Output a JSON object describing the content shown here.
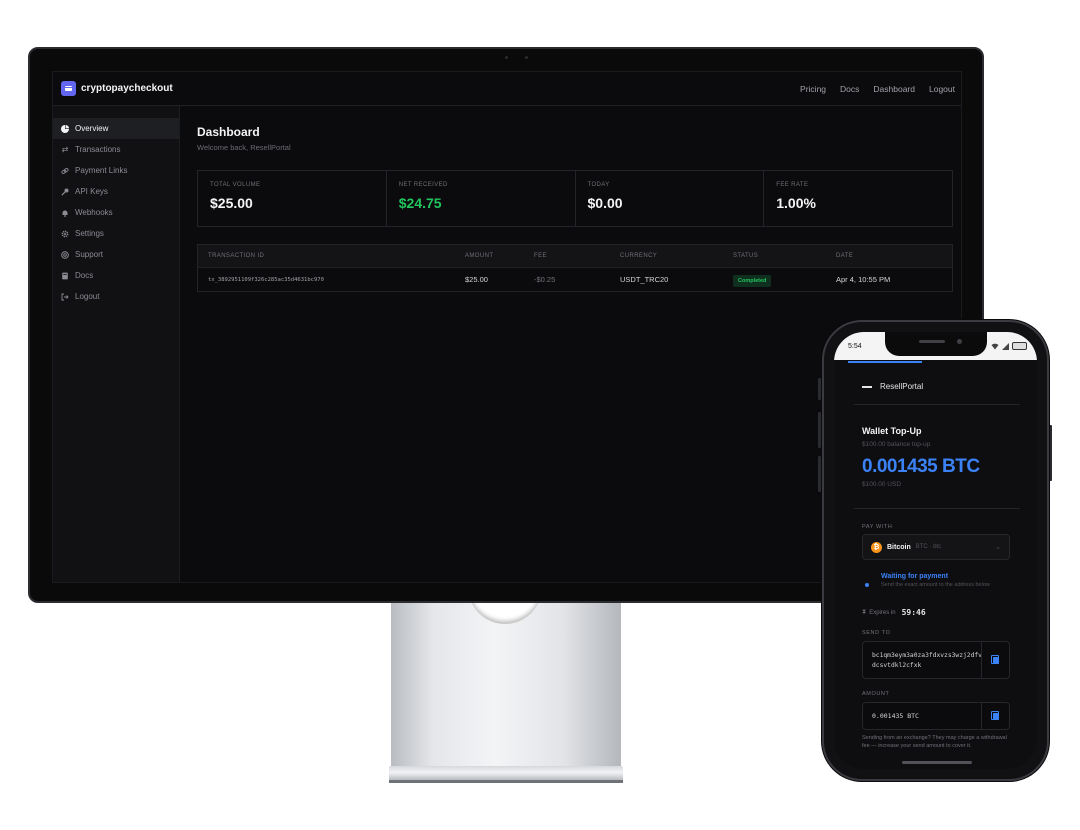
{
  "app": {
    "brand": "cryptopaycheckout",
    "nav": [
      "Pricing",
      "Docs",
      "Dashboard",
      "Logout"
    ]
  },
  "sidebar": {
    "items": [
      {
        "label": "Overview",
        "icon": "pie-chart-icon",
        "active": true
      },
      {
        "label": "Transactions",
        "icon": "arrows-swap-icon",
        "active": false
      },
      {
        "label": "Payment Links",
        "icon": "link-icon",
        "active": false
      },
      {
        "label": "API Keys",
        "icon": "key-icon",
        "active": false
      },
      {
        "label": "Webhooks",
        "icon": "bell-icon",
        "active": false
      },
      {
        "label": "Settings",
        "icon": "gear-icon",
        "active": false
      },
      {
        "label": "Support",
        "icon": "lifebuoy-icon",
        "active": false
      },
      {
        "label": "Docs",
        "icon": "book-icon",
        "active": false
      },
      {
        "label": "Logout",
        "icon": "logout-icon",
        "active": false
      }
    ]
  },
  "dashboard": {
    "title": "Dashboard",
    "subtitle": "Welcome back, ResellPortal",
    "stats": [
      {
        "label": "TOTAL VOLUME",
        "value": "$25.00",
        "accent": "#f4f4f5"
      },
      {
        "label": "NET RECEIVED",
        "value": "$24.75",
        "accent": "#22c55e"
      },
      {
        "label": "TODAY",
        "value": "$0.00",
        "accent": "#f4f4f5"
      },
      {
        "label": "FEE RATE",
        "value": "1.00%",
        "accent": "#f4f4f5"
      }
    ],
    "table": {
      "headers": [
        "TRANSACTION ID",
        "AMOUNT",
        "FEE",
        "CURRENCY",
        "STATUS",
        "DATE"
      ],
      "rows": [
        {
          "id": "tx_3892951109f326c285ac35d4631bc970",
          "amount": "$25.00",
          "fee": "-$0.25",
          "currency": "USDT_TRC20",
          "status": "Completed",
          "date": "Apr 4, 10:55 PM"
        }
      ]
    }
  },
  "phone": {
    "status_time": "5:54",
    "merchant": "ResellPortal",
    "title": "Wallet Top-Up",
    "subtitle": "$100.00 balance top-up",
    "amount_crypto": "0.001435 BTC",
    "amount_usd": "$100.00 USD",
    "pay_with_label": "PAY WITH",
    "coin_name": "Bitcoin",
    "coin_tag": "BTC · btc",
    "waiting_title": "Waiting for payment",
    "waiting_desc": "Send the exact amount to the address below",
    "expires_label": "Expires in",
    "expires_time": "59:46",
    "send_to_label": "SEND TO",
    "address": "bc1qm3eym3a0za3fdxvzs3wzj2dfvdcsvtdkl2cfxk",
    "amount_label": "AMOUNT",
    "amount_value": "0.001435  BTC",
    "note": "Sending from an exchange? They may charge a withdrawal fee — increase your send amount to cover it.",
    "accent": "#3b82f6"
  }
}
